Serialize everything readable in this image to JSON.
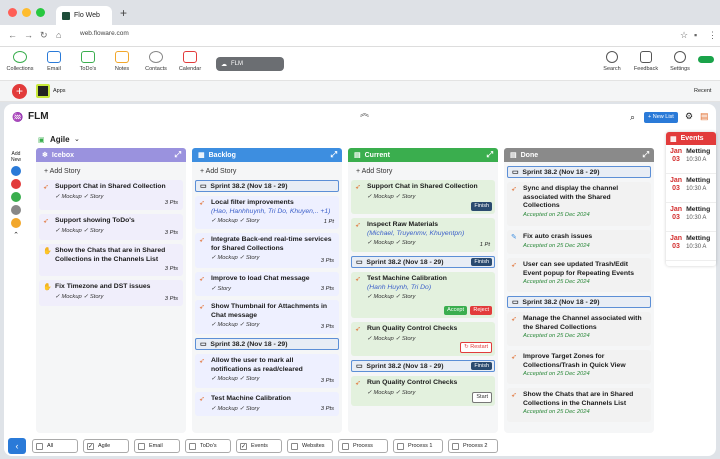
{
  "browser": {
    "tab_title": "Flo Web",
    "url": "web.floware.com"
  },
  "appbar": {
    "items": [
      {
        "label": "Collections",
        "icon": "collections-icon"
      },
      {
        "label": "Email",
        "icon": "email-icon"
      },
      {
        "label": "ToDo's",
        "icon": "todo-icon"
      },
      {
        "label": "Notes",
        "icon": "notes-icon"
      },
      {
        "label": "Contacts",
        "icon": "contacts-icon"
      },
      {
        "label": "Calendar",
        "icon": "calendar-icon"
      }
    ],
    "active_collection": "FLM",
    "right": [
      {
        "label": "Search"
      },
      {
        "label": "Feedback"
      },
      {
        "label": "Settings"
      }
    ]
  },
  "subbar": {
    "apps_label": "Apps",
    "recent_label": "Recent"
  },
  "board": {
    "title": "FLM",
    "view": "Agile",
    "new_list_label": "+ New List",
    "add_new_label": "Add New",
    "add_story_label": "+ Add Story"
  },
  "columns": [
    {
      "title": "Icebox",
      "color": "#9a92de",
      "cards": [
        {
          "title": "Support Chat in Shared Collection",
          "meta": "✓ Mockup  ✓ Story",
          "pts": "3 Pts"
        },
        {
          "title": "Support showing ToDo's",
          "meta": "✓ Mockup  ✓ Story",
          "pts": "3 Pts"
        },
        {
          "title": "Show the Chats that are in Shared Collections in the Channels List",
          "meta": "",
          "pts": "3 Pts"
        },
        {
          "title": "Fix Timezone and DST issues",
          "meta": "✓ Mockup  ✓ Story",
          "pts": "3 Pts"
        }
      ]
    },
    {
      "title": "Backlog",
      "color": "#3d8ee0",
      "sprint1": "Sprint 38.2 (Nov 18 - 29)",
      "cards1": [
        {
          "title": "Local filter improvements",
          "asg": "(Hao, Hanhhuynh, Tri Do, Khuyen,.. +1)",
          "meta": "✓ Mockup  ✓ Story",
          "pts": "1 Pt"
        },
        {
          "title": "Integrate Back-end real-time services for Shared Collections",
          "meta": "✓ Mockup  ✓ Story",
          "pts": "3 Pts"
        },
        {
          "title": "Improve to load Chat message",
          "meta": "✓ Story",
          "pts": "3 Pts"
        },
        {
          "title": "Show Thumbnail for Attachments in Chat message",
          "meta": "✓ Mockup  ✓ Story",
          "pts": "3 Pts"
        }
      ],
      "sprint2": "Sprint 38.2 (Nov 18 - 29)",
      "cards2": [
        {
          "title": "Allow the user to mark all notifications as read/cleared",
          "meta": "✓ Mockup  ✓ Story",
          "pts": "3 Pts"
        },
        {
          "title": "Test Machine Calibration",
          "meta": "✓ Mockup  ✓ Story",
          "pts": "3 Pts"
        }
      ]
    },
    {
      "title": "Current",
      "color": "#3aae4e",
      "c1": {
        "title": "Support Chat in Shared Collection",
        "meta": "✓ Mockup  ✓ Story",
        "btn": "Finish"
      },
      "c2": {
        "title": "Inspect Raw Materials",
        "asg": "(Michael, Truyenmv, Khuyentpn)",
        "meta": "✓ Mockup  ✓ Story",
        "pts": "1 Pt"
      },
      "sprint1": "Sprint 38.2 (Nov 18 - 29)",
      "sprint1_btn": "Finish",
      "c3": {
        "title": "Test Machine Calibration",
        "asg": "(Hanh Huynh, Tri Do)",
        "meta": "✓ Mockup  ✓ Story",
        "accept": "Accept",
        "reject": "Reject"
      },
      "c4": {
        "title": "Run Quality Control Checks",
        "meta": "✓ Mockup  ✓ Story",
        "btn": "↻ Restart"
      },
      "sprint2": "Sprint 38.2 (Nov 18 - 29)",
      "sprint2_btn": "Finish",
      "c5": {
        "title": "Run Quality Control Checks",
        "meta": "✓ Mockup  ✓ Story",
        "btn": "Start"
      }
    },
    {
      "title": "Done",
      "color": "#8a8a8a",
      "sprint1": "Sprint 38.2 (Nov 18 - 29)",
      "cards1": [
        {
          "title": "Sync and display the channel associated with the Shared Collections",
          "acc": "Accepted on 25 Dec 2024"
        },
        {
          "title": "Fix auto crash issues",
          "acc": "Accepted on 25 Dec 2024"
        },
        {
          "title": "User can see updated Trash/Edit Event popup for Repeating Events",
          "acc": "Accepted on 25 Dec 2024"
        }
      ],
      "sprint2": "Sprint 38.2 (Nov 18 - 29)",
      "cards2": [
        {
          "title": "Manage the Channel associated with the Shared Collections",
          "acc": "Accepted on 25 Dec 2024"
        },
        {
          "title": "Improve Target Zones for Collections/Trash in Quick View",
          "acc": "Accepted on 25 Dec 2024"
        },
        {
          "title": "Show the Chats that are in Shared Collections in the Channels List",
          "acc": "Accepted on 25 Dec 2024"
        }
      ]
    }
  ],
  "events": {
    "title": "Events",
    "items": [
      {
        "m": "Jan",
        "d": "03",
        "t": "Metting",
        "time": "10:30 A"
      },
      {
        "m": "Jan",
        "d": "03",
        "t": "Metting",
        "time": "10:30 A"
      },
      {
        "m": "Jan",
        "d": "03",
        "t": "Metting",
        "time": "10:30 A"
      },
      {
        "m": "Jan",
        "d": "03",
        "t": "Metting",
        "time": "10:30 A"
      }
    ]
  },
  "filters": [
    {
      "label": "All",
      "checked": false
    },
    {
      "label": "Agile",
      "checked": true
    },
    {
      "label": "Email",
      "checked": false
    },
    {
      "label": "ToDo's",
      "checked": false
    },
    {
      "label": "Events",
      "checked": true
    },
    {
      "label": "Websites",
      "checked": false
    },
    {
      "label": "Process",
      "checked": false
    },
    {
      "label": "Process 1",
      "checked": false
    },
    {
      "label": "Process 2",
      "checked": false
    }
  ]
}
